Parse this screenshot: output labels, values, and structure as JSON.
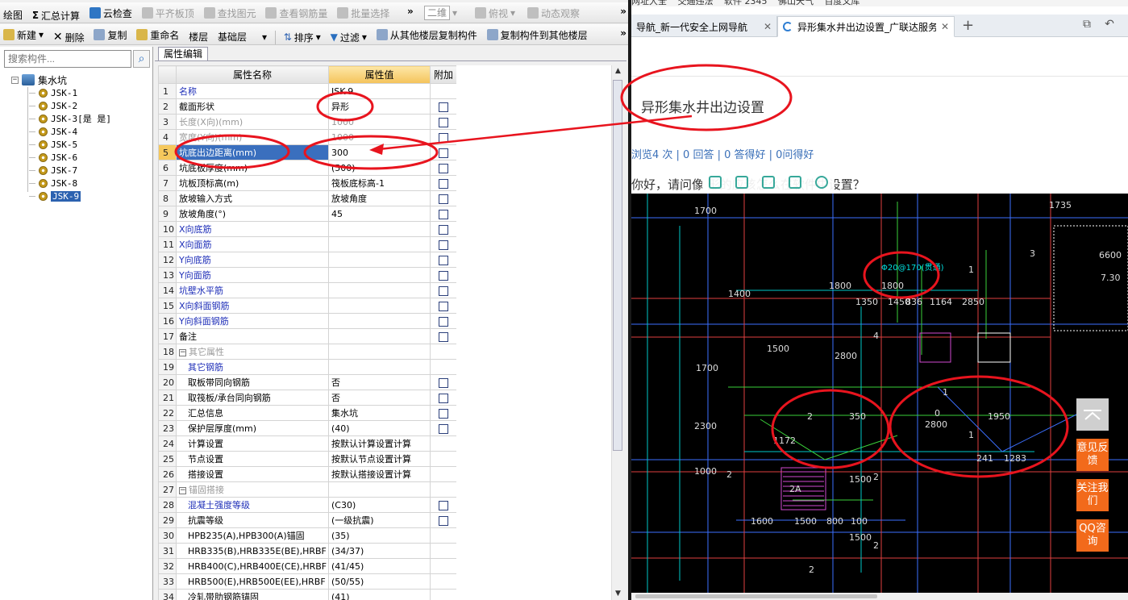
{
  "toolbar1": {
    "items": [
      "绘图",
      "汇总计算",
      "云检查",
      "平齐板顶",
      "查找图元",
      "查看钢筋量",
      "批量选择"
    ],
    "view_combo": "二维",
    "view_label": "俯视",
    "dynamic_label": "动态观察"
  },
  "toolbar2": {
    "new": "新建",
    "delete": "删除",
    "copy": "复制",
    "rename": "重命名",
    "floor_label": "楼层",
    "floor_value": "基础层",
    "sort": "排序",
    "filter": "过滤",
    "copy_from": "从其他楼层复制构件",
    "copy_to": "复制构件到其他楼层"
  },
  "tree": {
    "search_placeholder": "搜索构件...",
    "root": "集水坑",
    "items": [
      "JSK-1",
      "JSK-2",
      "JSK-3[是 是]",
      "JSK-4",
      "JSK-5",
      "JSK-6",
      "JSK-7",
      "JSK-8",
      "JSK-9"
    ],
    "selected": "JSK-9"
  },
  "props": {
    "tab": "属性编辑",
    "headers": {
      "name": "属性名称",
      "value": "属性值",
      "extra": "附加"
    },
    "rows": [
      {
        "n": "1",
        "name": "名称",
        "value": "JSK-9",
        "cls": "blue",
        "cb": false
      },
      {
        "n": "2",
        "name": "截面形状",
        "value": "异形",
        "cls": "",
        "cb": true
      },
      {
        "n": "3",
        "name": "长度(X向)(mm)",
        "value": "1000",
        "cls": "gray",
        "cb": true
      },
      {
        "n": "4",
        "name": "宽度(Y向)(mm)",
        "value": "1000",
        "cls": "gray",
        "cb": true
      },
      {
        "n": "5",
        "name": "坑底出边距离(mm)",
        "value": "300",
        "cls": "",
        "cb": true,
        "sel": true
      },
      {
        "n": "6",
        "name": "坑底板厚度(mm)",
        "value": "(500)",
        "cls": "",
        "cb": true
      },
      {
        "n": "7",
        "name": "坑板顶标高(m)",
        "value": "筏板底标高-1",
        "cls": "",
        "cb": true
      },
      {
        "n": "8",
        "name": "放坡输入方式",
        "value": "放坡角度",
        "cls": "",
        "cb": true
      },
      {
        "n": "9",
        "name": "放坡角度(°)",
        "value": "45",
        "cls": "",
        "cb": true
      },
      {
        "n": "10",
        "name": "X向底筋",
        "value": "",
        "cls": "blue",
        "cb": true
      },
      {
        "n": "11",
        "name": "X向面筋",
        "value": "",
        "cls": "blue",
        "cb": true
      },
      {
        "n": "12",
        "name": "Y向底筋",
        "value": "",
        "cls": "blue",
        "cb": true
      },
      {
        "n": "13",
        "name": "Y向面筋",
        "value": "",
        "cls": "blue",
        "cb": true
      },
      {
        "n": "14",
        "name": "坑壁水平筋",
        "value": "",
        "cls": "blue",
        "cb": true
      },
      {
        "n": "15",
        "name": "X向斜面钢筋",
        "value": "",
        "cls": "blue",
        "cb": true
      },
      {
        "n": "16",
        "name": "Y向斜面钢筋",
        "value": "",
        "cls": "blue",
        "cb": true
      },
      {
        "n": "17",
        "name": "备注",
        "value": "",
        "cls": "",
        "cb": true
      },
      {
        "n": "18",
        "name": "其它属性",
        "value": "",
        "cls": "gray",
        "cb": false,
        "group": true
      },
      {
        "n": "19",
        "name": "其它钢筋",
        "value": "",
        "cls": "blue",
        "cb": false,
        "indent": true
      },
      {
        "n": "20",
        "name": "取板带同向钢筋",
        "value": "否",
        "cls": "",
        "cb": true,
        "indent": true
      },
      {
        "n": "21",
        "name": "取筏板/承台同向钢筋",
        "value": "否",
        "cls": "",
        "cb": true,
        "indent": true
      },
      {
        "n": "22",
        "name": "汇总信息",
        "value": "集水坑",
        "cls": "",
        "cb": true,
        "indent": true
      },
      {
        "n": "23",
        "name": "保护层厚度(mm)",
        "value": "(40)",
        "cls": "",
        "cb": true,
        "indent": true
      },
      {
        "n": "24",
        "name": "计算设置",
        "value": "按默认计算设置计算",
        "cls": "",
        "cb": false,
        "indent": true
      },
      {
        "n": "25",
        "name": "节点设置",
        "value": "按默认节点设置计算",
        "cls": "",
        "cb": false,
        "indent": true
      },
      {
        "n": "26",
        "name": "搭接设置",
        "value": "按默认搭接设置计算",
        "cls": "",
        "cb": false,
        "indent": true
      },
      {
        "n": "27",
        "name": "锚固搭接",
        "value": "",
        "cls": "gray",
        "cb": false,
        "group": true
      },
      {
        "n": "28",
        "name": "混凝土强度等级",
        "value": "(C30)",
        "cls": "blue",
        "cb": true,
        "indent": true
      },
      {
        "n": "29",
        "name": "抗震等级",
        "value": "(一级抗震)",
        "cls": "",
        "cb": true,
        "indent": true
      },
      {
        "n": "30",
        "name": "HPB235(A),HPB300(A)锚固",
        "value": "(35)",
        "cls": "",
        "cb": false,
        "indent": true
      },
      {
        "n": "31",
        "name": "HRB335(B),HRB335E(BE),HRBF",
        "value": "(34/37)",
        "cls": "",
        "cb": false,
        "indent": true
      },
      {
        "n": "32",
        "name": "HRB400(C),HRB400E(CE),HRBF",
        "value": "(41/45)",
        "cls": "",
        "cb": false,
        "indent": true
      },
      {
        "n": "33",
        "name": "HRB500(E),HRB500E(EE),HRBF",
        "value": "(50/55)",
        "cls": "",
        "cb": false,
        "indent": true
      },
      {
        "n": "34",
        "name": "冷轧带肋钢筋锚固",
        "value": "(41)",
        "cls": "",
        "cb": false,
        "indent": true
      }
    ]
  },
  "browser": {
    "bookmarks": [
      "网址大全",
      "交通违法",
      "软件 2345",
      "佛山天气",
      "百度文库"
    ],
    "tabs": [
      {
        "title": "导航_新一代安全上网导航",
        "active": false
      },
      {
        "title": "异形集水井出边设置_广联达服务",
        "active": true
      }
    ],
    "question_title": "异形集水井出边设置",
    "meta": "浏览4 次 | 0 回答 | 0 答得好 | 0问得好",
    "question_text": "你好，请问像                  形的应该怎么在软件中设置？",
    "side_buttons": [
      "意见反馈",
      "关注我们",
      "QQ咨询"
    ]
  },
  "cad": {
    "labels": [
      "1700",
      "1400",
      "1500",
      "1700",
      "2300",
      "1000",
      "2",
      "1800",
      "1350",
      "1450",
      "836",
      "1164",
      "2850",
      "1",
      "3",
      "4",
      "1735",
      "6600",
      "7.30",
      "1800",
      "2800",
      "2",
      "1172",
      "350",
      "2800",
      "0",
      "1",
      "1950",
      "241",
      "1283",
      "1600",
      "1500",
      "800",
      "100",
      "2",
      "2A",
      "1",
      "2",
      "1500",
      "1500",
      "2"
    ],
    "rebar_label": "Φ20@170(贯通)"
  },
  "colors": {
    "annotation": "#e8141e",
    "selection": "#3a6fbe",
    "cad_bg": "#000000",
    "accent": "#f26a1b"
  }
}
